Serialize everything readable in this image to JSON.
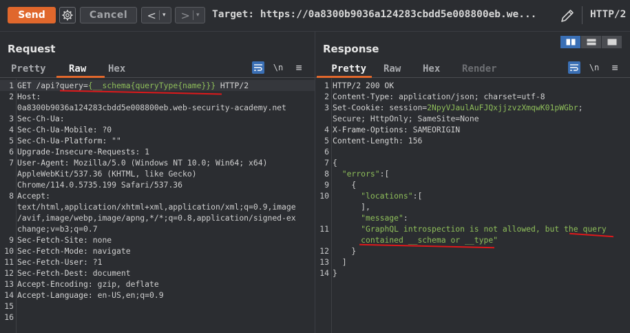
{
  "toolbar": {
    "send_label": "Send",
    "cancel_label": "Cancel",
    "back_glyph": "<",
    "forward_glyph": ">",
    "caret_glyph": "▾",
    "target_label": "Target: https://0a8300b9036a124283cbdd5e008800eb.we...",
    "http_version": "HTTP/2",
    "icons": [
      "gear-icon",
      "pencil-icon",
      "back-arrow-icon",
      "forward-arrow-icon"
    ]
  },
  "request": {
    "title": "Request",
    "tabs": [
      {
        "label": "Pretty",
        "active": false
      },
      {
        "label": "Raw",
        "active": true
      },
      {
        "label": "Hex",
        "active": false
      }
    ],
    "newline_label": "\\n",
    "menu_glyph": "≡",
    "lines": [
      {
        "n": "1",
        "parts": [
          [
            "k",
            "GET /api?"
          ],
          [
            "k",
            "query="
          ],
          [
            "g",
            "{__schema{queryType{name}}}"
          ],
          [
            "k",
            " HTTP/2"
          ]
        ]
      },
      {
        "n": "2",
        "parts": [
          [
            "k",
            "Host:"
          ]
        ]
      },
      {
        "n": "",
        "parts": [
          [
            "t",
            "0a8300b9036a124283cbdd5e008800eb.web-security-academy.net"
          ]
        ]
      },
      {
        "n": "3",
        "parts": [
          [
            "k",
            "Sec-Ch-Ua:"
          ]
        ]
      },
      {
        "n": "4",
        "parts": [
          [
            "k",
            "Sec-Ch-Ua-Mobile:"
          ],
          [
            "t",
            " ?0"
          ]
        ]
      },
      {
        "n": "5",
        "parts": [
          [
            "k",
            "Sec-Ch-Ua-Platform:"
          ],
          [
            "t",
            " \"\""
          ]
        ]
      },
      {
        "n": "6",
        "parts": [
          [
            "k",
            "Upgrade-Insecure-Requests:"
          ],
          [
            "t",
            " 1"
          ]
        ]
      },
      {
        "n": "7",
        "parts": [
          [
            "k",
            "User-Agent:"
          ],
          [
            "t",
            " Mozilla/5.0 (Windows NT 10.0; Win64; x64)"
          ]
        ]
      },
      {
        "n": "",
        "parts": [
          [
            "t",
            "AppleWebKit/537.36 (KHTML, like Gecko)"
          ]
        ]
      },
      {
        "n": "",
        "parts": [
          [
            "t",
            "Chrome/114.0.5735.199 Safari/537.36"
          ]
        ]
      },
      {
        "n": "8",
        "parts": [
          [
            "k",
            "Accept:"
          ]
        ]
      },
      {
        "n": "",
        "parts": [
          [
            "t",
            "text/html,application/xhtml+xml,application/xml;q=0.9,image"
          ]
        ]
      },
      {
        "n": "",
        "parts": [
          [
            "t",
            "/avif,image/webp,image/apng,*/*;q=0.8,application/signed-ex"
          ]
        ]
      },
      {
        "n": "",
        "parts": [
          [
            "t",
            "change;v=b3;q=0.7"
          ]
        ]
      },
      {
        "n": "9",
        "parts": [
          [
            "k",
            "Sec-Fetch-Site:"
          ],
          [
            "t",
            " none"
          ]
        ]
      },
      {
        "n": "10",
        "parts": [
          [
            "k",
            "Sec-Fetch-Mode:"
          ],
          [
            "t",
            " navigate"
          ]
        ]
      },
      {
        "n": "11",
        "parts": [
          [
            "k",
            "Sec-Fetch-User:"
          ],
          [
            "t",
            " ?1"
          ]
        ]
      },
      {
        "n": "12",
        "parts": [
          [
            "k",
            "Sec-Fetch-Dest:"
          ],
          [
            "t",
            " document"
          ]
        ]
      },
      {
        "n": "13",
        "parts": [
          [
            "k",
            "Accept-Encoding:"
          ],
          [
            "t",
            " gzip, deflate"
          ]
        ]
      },
      {
        "n": "14",
        "parts": [
          [
            "k",
            "Accept-Language:"
          ],
          [
            "t",
            " en-US,en;q=0.9"
          ]
        ]
      },
      {
        "n": "15",
        "parts": []
      },
      {
        "n": "16",
        "parts": []
      }
    ]
  },
  "response": {
    "title": "Response",
    "tabs": [
      {
        "label": "Pretty",
        "active": true
      },
      {
        "label": "Raw",
        "active": false
      },
      {
        "label": "Hex",
        "active": false
      },
      {
        "label": "Render",
        "active": false,
        "disabled": true
      }
    ],
    "newline_label": "\\n",
    "menu_glyph": "≡",
    "layout_modes": [
      "split-horizontal-icon",
      "split-vertical-icon",
      "single-pane-icon"
    ],
    "lines": [
      {
        "n": "1",
        "parts": [
          [
            "k",
            "HTTP/2 200 OK"
          ]
        ]
      },
      {
        "n": "2",
        "parts": [
          [
            "k",
            "Content-Type:"
          ],
          [
            "t",
            " application/json; charset=utf-8"
          ]
        ]
      },
      {
        "n": "3",
        "parts": [
          [
            "k",
            "Set-Cookie:"
          ],
          [
            "t",
            " session="
          ],
          [
            "g",
            "2NpyVJaulAuFJQxjjzvzXmqwK01pWGbr"
          ],
          [
            "t",
            ";"
          ]
        ]
      },
      {
        "n": "",
        "parts": [
          [
            "t",
            "Secure; HttpOnly; SameSite=None"
          ]
        ]
      },
      {
        "n": "4",
        "parts": [
          [
            "k",
            "X-Frame-Options:"
          ],
          [
            "t",
            " SAMEORIGIN"
          ]
        ]
      },
      {
        "n": "5",
        "parts": [
          [
            "k",
            "Content-Length:"
          ],
          [
            "t",
            " 156"
          ]
        ]
      },
      {
        "n": "6",
        "parts": []
      },
      {
        "n": "7",
        "parts": [
          [
            "t",
            "{"
          ]
        ]
      },
      {
        "n": "8",
        "parts": [
          [
            "t",
            "  "
          ],
          [
            "g",
            "\"errors\""
          ],
          [
            "t",
            ":["
          ]
        ]
      },
      {
        "n": "9",
        "parts": [
          [
            "t",
            "    {"
          ]
        ]
      },
      {
        "n": "10",
        "parts": [
          [
            "t",
            "      "
          ],
          [
            "g",
            "\"locations\""
          ],
          [
            "t",
            ":["
          ]
        ]
      },
      {
        "n": "",
        "parts": [
          [
            "t",
            "      ],"
          ]
        ]
      },
      {
        "n": "",
        "parts": [
          [
            "t",
            "      "
          ],
          [
            "g",
            "\"message\""
          ],
          [
            "t",
            ":"
          ]
        ]
      },
      {
        "n": "11",
        "parts": [
          [
            "t",
            "      "
          ],
          [
            "g",
            "\"GraphQL introspection is not allowed, but the query"
          ]
        ]
      },
      {
        "n": "",
        "parts": [
          [
            "t",
            "      "
          ],
          [
            "g",
            "contained __schema or __type\""
          ]
        ]
      },
      {
        "n": "12",
        "parts": [
          [
            "t",
            "    }"
          ]
        ]
      },
      {
        "n": "13",
        "parts": [
          [
            "t",
            "  ]"
          ]
        ]
      },
      {
        "n": "14",
        "parts": [
          [
            "t",
            "}"
          ]
        ]
      }
    ]
  },
  "colors": {
    "accent": "#e0672c",
    "background": "#2b2d31",
    "string_green": "#8fbf5a",
    "annotation_red": "#e0191b",
    "active_blue": "#3a6fb5"
  }
}
